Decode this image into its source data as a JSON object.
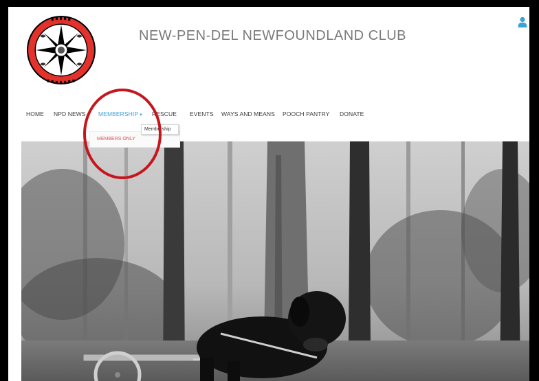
{
  "site": {
    "title": "NEW-PEN-DEL NEWFOUNDLAND CLUB",
    "logo_icon": "compass-rose-logo-icon"
  },
  "header": {
    "user_icon": "user-icon"
  },
  "nav": {
    "items": [
      {
        "label": "HOME",
        "active": false
      },
      {
        "label": "NPD NEWS",
        "active": false
      },
      {
        "label": "MEMBERSHIP",
        "active": true
      },
      {
        "label": "RESCUE",
        "active": false
      },
      {
        "label": "EVENTS",
        "active": false
      },
      {
        "label": "WAYS AND MEANS",
        "active": false
      },
      {
        "label": "POOCH PANTRY",
        "active": false
      },
      {
        "label": "DONATE",
        "active": false
      }
    ],
    "caret": "▾"
  },
  "dropdown": {
    "items": [
      {
        "label": "MEMBERS ONLY"
      }
    ]
  },
  "tooltip": {
    "text": "Membership"
  },
  "hero": {
    "image_icon": "forest-newfoundland-dog-cart-photo"
  },
  "colors": {
    "accent": "#3aa3d8",
    "dropdown_text": "#d9534f",
    "logo_red": "#e2322b",
    "annotation_red": "#c4161c"
  }
}
